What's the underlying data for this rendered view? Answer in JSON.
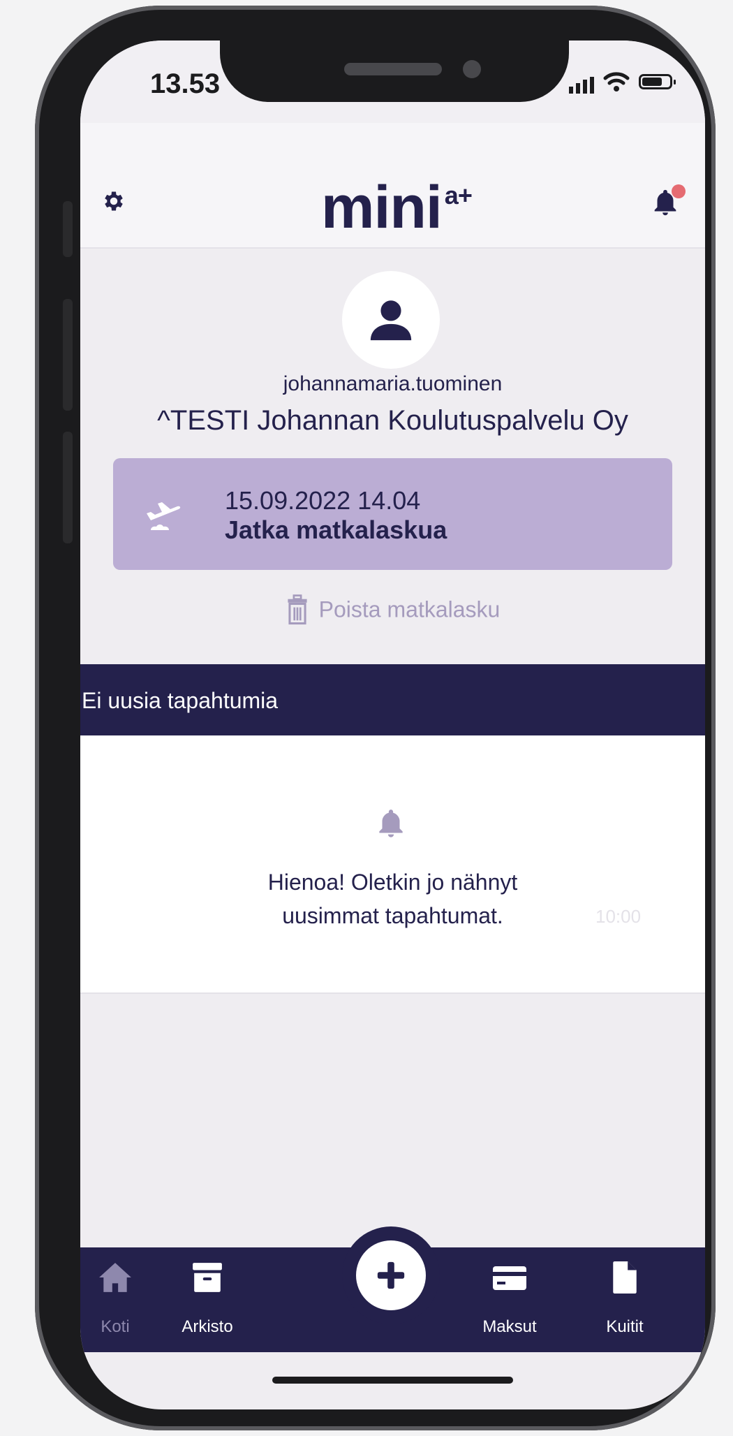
{
  "status_bar": {
    "time": "13.53"
  },
  "header": {
    "logo_main": "mini",
    "logo_sup": "a+"
  },
  "profile": {
    "username": "johannamaria.tuominen",
    "company": "^TESTI Johannan Koulutuspalvelu Oy"
  },
  "travel_card": {
    "date": "15.09.2022 14.04",
    "action": "Jatka matkalaskua"
  },
  "delete_label": "Poista matkalasku",
  "events": {
    "title": "Ei uusia tapahtumia",
    "empty_message": "Hienoa! Oletkin jo nähnyt uusimmat tapahtumat.",
    "ghost_time": "10:00"
  },
  "bottom_nav": {
    "items": [
      {
        "label": "Koti",
        "icon": "home-icon",
        "active": true
      },
      {
        "label": "Arkisto",
        "icon": "archive-icon"
      },
      {
        "label": "Maksut",
        "icon": "card-icon"
      },
      {
        "label": "Kuitit",
        "icon": "document-icon"
      }
    ],
    "fab_icon": "plus-icon"
  },
  "colors": {
    "navy": "#24214c",
    "card_lilac": "#bbadd4",
    "muted_lilac": "#a59bbd",
    "notification_dot": "#e56b72"
  }
}
